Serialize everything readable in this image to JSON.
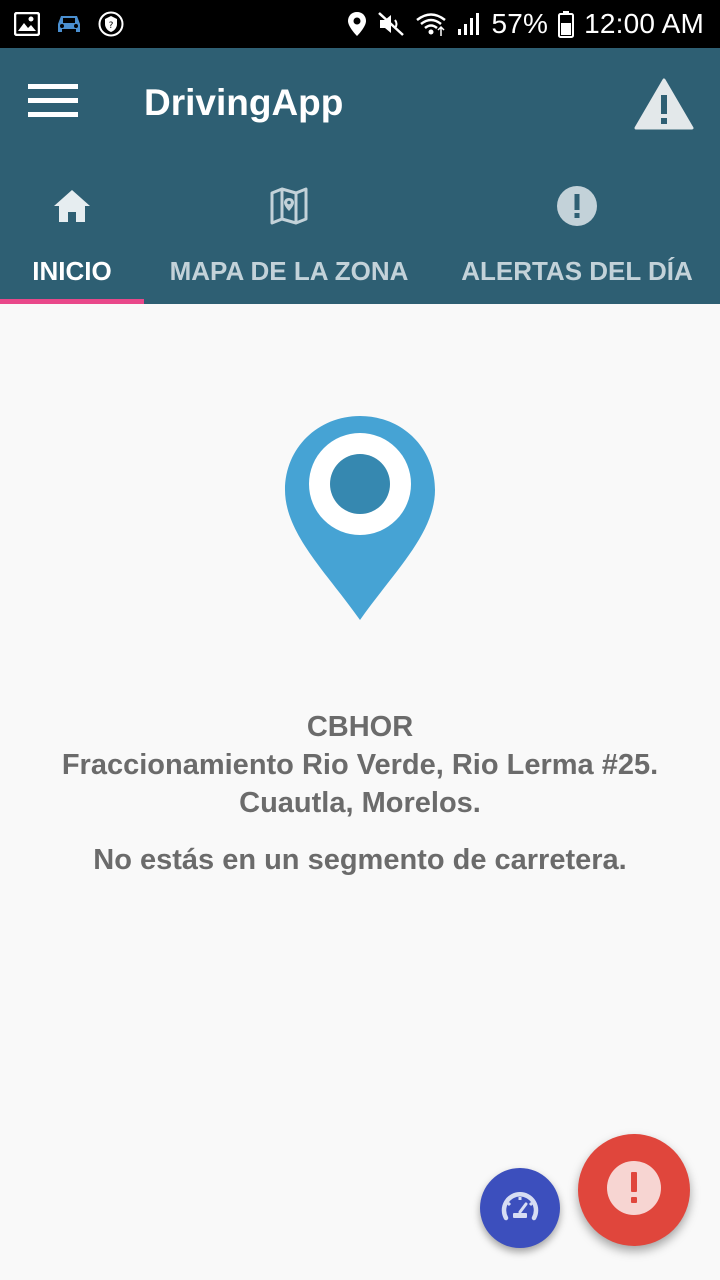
{
  "status_bar": {
    "battery": "57%",
    "time": "12:00 AM",
    "icons": [
      "gallery-icon",
      "car-icon",
      "shield-icon",
      "location-icon",
      "mute-icon",
      "wifi-icon",
      "signal-icon",
      "battery-icon"
    ]
  },
  "app_bar": {
    "title": "DrivingApp",
    "menu_icon": "hamburger-menu-icon",
    "action_icon": "warning-triangle-icon",
    "background": "#2e5f73"
  },
  "tabs": [
    {
      "label": "INICIO",
      "icon": "home-icon",
      "selected": true
    },
    {
      "label": "MAPA DE LA ZONA",
      "icon": "map-icon",
      "selected": false
    },
    {
      "label": "ALERTAS DEL DÍA",
      "icon": "alert-circle-icon",
      "selected": false
    }
  ],
  "indicator_color": "#e9488a",
  "location": {
    "icon": "location-pin-icon",
    "name": "CBHOR",
    "address_line1": "Fraccionamiento Rio Verde, Rio Lerma #25.",
    "address_line2": "Cuautla, Morelos.",
    "segment_status": "No estás en un segmento de carretera."
  },
  "fabs": {
    "speed": {
      "icon": "speedometer-icon",
      "color": "#3c4fbd"
    },
    "alert": {
      "icon": "exclamation-icon",
      "color": "#e0463c"
    }
  }
}
